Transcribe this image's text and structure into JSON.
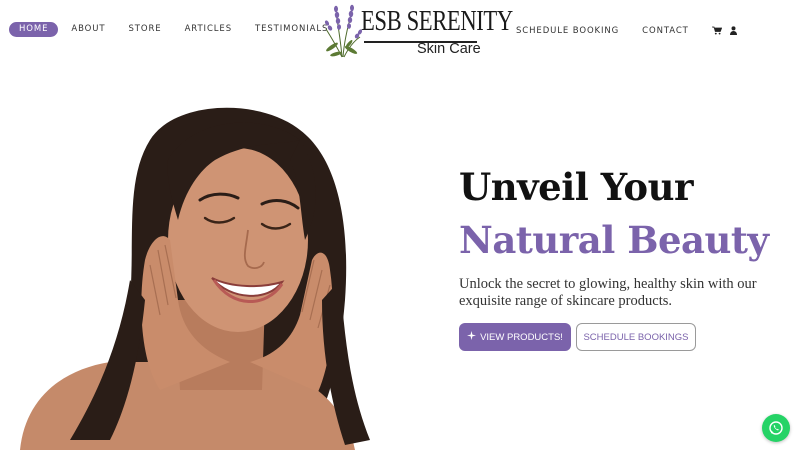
{
  "header": {
    "nav_left": [
      {
        "label": "Home",
        "active": true
      },
      {
        "label": "About",
        "active": false
      },
      {
        "label": "Store",
        "active": false
      },
      {
        "label": "Articles",
        "active": false
      },
      {
        "label": "Testimonials",
        "active": false
      }
    ],
    "logo": {
      "title": "ESB SERENITY",
      "subtitle": "Skin Care"
    },
    "nav_right": [
      {
        "label": "Schedule Booking"
      },
      {
        "label": "Contact"
      }
    ],
    "icons": [
      "cart-icon",
      "user-icon"
    ]
  },
  "hero": {
    "title_line1": "Unveil Your",
    "title_line2": "Natural Beauty",
    "description": "Unlock the secret to glowing, healthy skin with our exquisite range of skincare products.",
    "primary_button": {
      "label": "View Products!",
      "icon": "sparkle-icon"
    },
    "secondary_button": {
      "label": "Schedule Bookings"
    }
  },
  "floating": {
    "icon": "whatsapp-icon"
  },
  "colors": {
    "accent": "#7b63ab",
    "chat": "#25d366",
    "text": "#111111"
  }
}
